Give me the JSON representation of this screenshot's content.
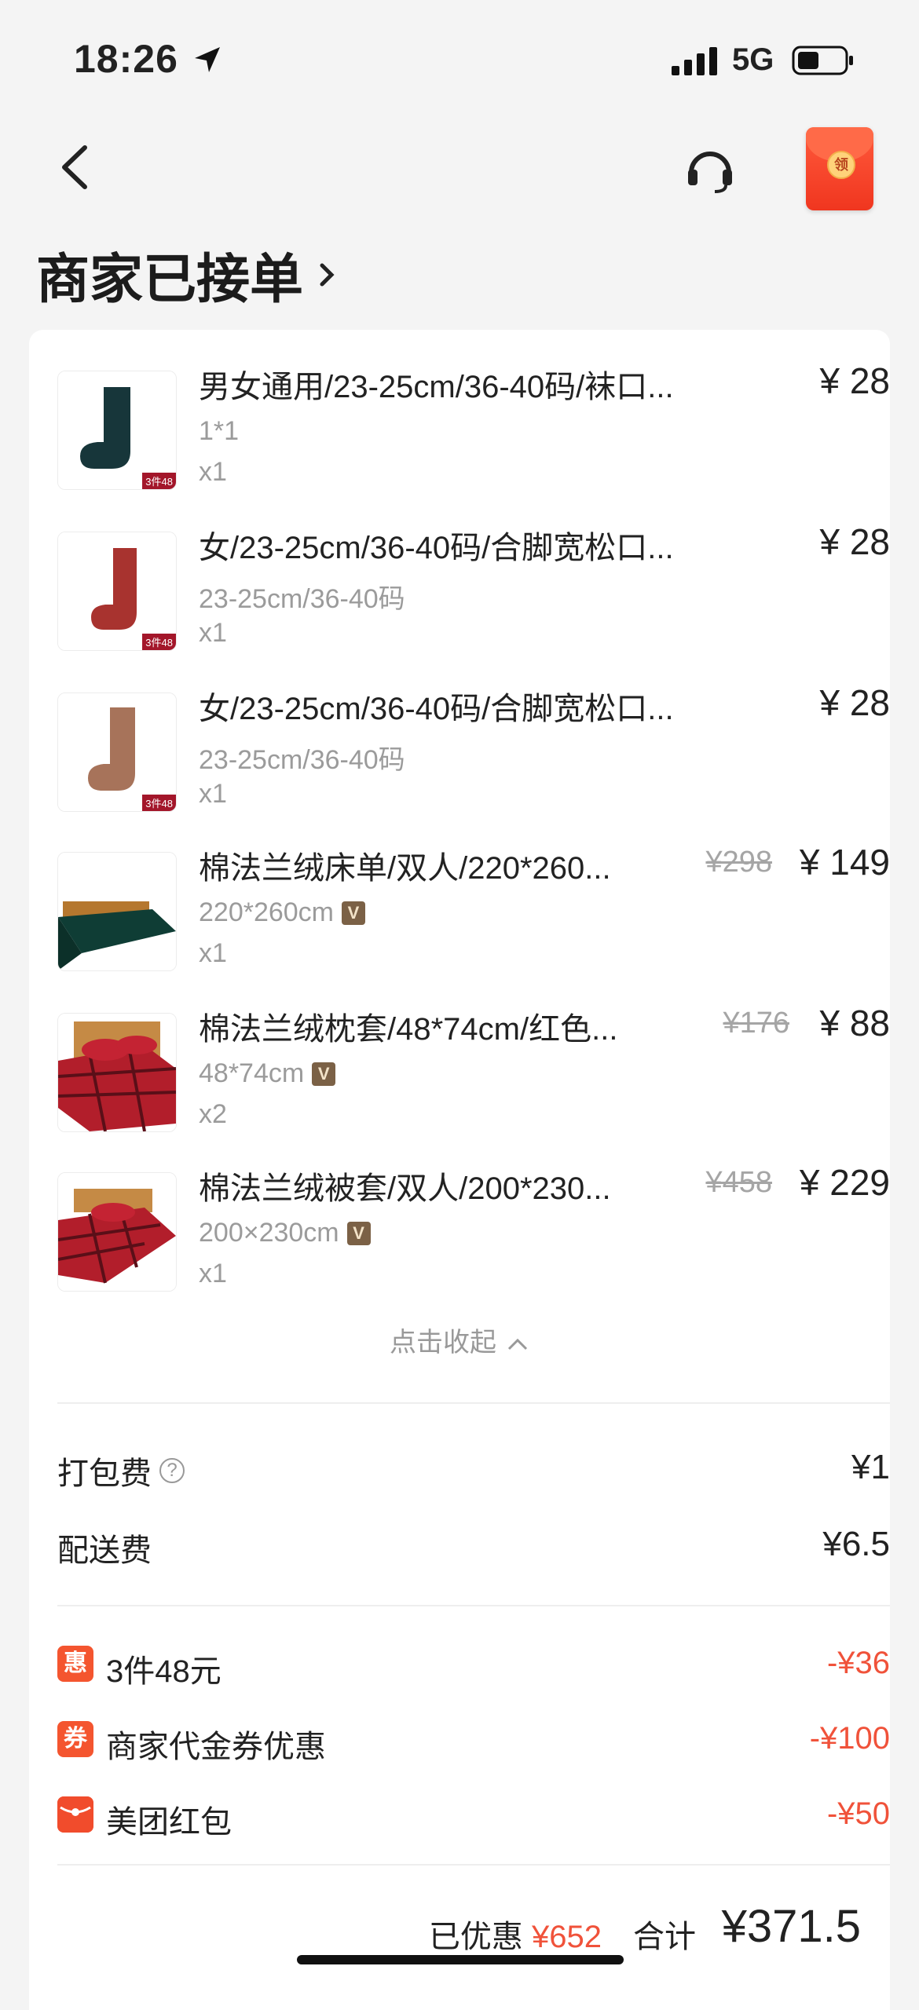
{
  "status_bar": {
    "time": "18:26",
    "network": "5G"
  },
  "header": {
    "status_title": "商家已接单"
  },
  "items": [
    {
      "name": "男女通用/23-25cm/36-40码/袜口...",
      "spec": "1*1",
      "qty": "x1",
      "orig_price": "",
      "price": "¥ 28",
      "thumb": "sock-dark-green",
      "verified": false
    },
    {
      "name": "女/23-25cm/36-40码/合脚宽松口...",
      "spec": "23-25cm/36-40码",
      "qty": "x1",
      "orig_price": "",
      "price": "¥ 28",
      "thumb": "sock-red",
      "verified": false
    },
    {
      "name": "女/23-25cm/36-40码/合脚宽松口...",
      "spec": "23-25cm/36-40码",
      "qty": "x1",
      "orig_price": "",
      "price": "¥ 28",
      "thumb": "sock-brown",
      "verified": false
    },
    {
      "name": "棉法兰绒床单/双人/220*260...",
      "spec": "220*260cm",
      "qty": "x1",
      "orig_price": "¥298",
      "price": "¥ 149",
      "thumb": "bedsheet-green",
      "verified": true
    },
    {
      "name": "棉法兰绒枕套/48*74cm/红色...",
      "spec": "48*74cm",
      "qty": "x2",
      "orig_price": "¥176",
      "price": "¥ 88",
      "thumb": "pillowcase-red-plaid",
      "verified": true
    },
    {
      "name": "棉法兰绒被套/双人/200*230...",
      "spec": "200×230cm",
      "qty": "x1",
      "orig_price": "¥458",
      "price": "¥ 229",
      "thumb": "duvet-red-plaid",
      "verified": true
    }
  ],
  "thumb_tag": "3件48",
  "collapse_label": "点击收起",
  "fees": [
    {
      "label": "打包费",
      "value": "¥1",
      "help": true
    },
    {
      "label": "配送费",
      "value": "¥6.5",
      "help": false
    }
  ],
  "discounts": [
    {
      "icon_text": "惠",
      "label": "3件48元",
      "value": "-¥36"
    },
    {
      "icon_text": "券",
      "label": "商家代金券优惠",
      "value": "-¥100"
    },
    {
      "icon_text": "",
      "label": "美团红包",
      "value": "-¥50"
    }
  ],
  "summary": {
    "saved_label": "已优惠",
    "saved_amount": "¥652",
    "total_label": "合计",
    "total_value": "¥371.5"
  },
  "redpacket_text": "领",
  "colors": {
    "accent_red": "#f0523a",
    "background": "#f4f4f4"
  }
}
